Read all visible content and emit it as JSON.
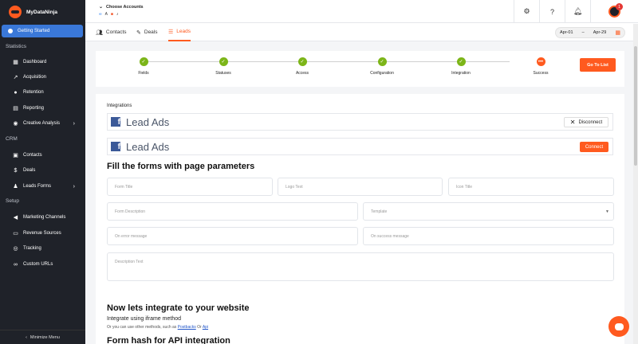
{
  "brand": {
    "name": "MyDataNinja"
  },
  "sidebar": {
    "getting_started": "Getting Started",
    "sections": {
      "statistics": "Statistics",
      "crm": "CRM",
      "setup": "Setup"
    },
    "statistics_items": [
      {
        "label": "Dashboard",
        "icon": "dashboard-icon"
      },
      {
        "label": "Acquisition",
        "icon": "trend-icon"
      },
      {
        "label": "Retention",
        "icon": "users-icon"
      },
      {
        "label": "Reporting",
        "icon": "report-icon"
      },
      {
        "label": "Creative Analysis",
        "icon": "palette-icon"
      }
    ],
    "crm_items": [
      {
        "label": "Contacts",
        "icon": "contacts-icon"
      },
      {
        "label": "Deals",
        "icon": "dollar-icon"
      },
      {
        "label": "Leads Forms",
        "icon": "leads-icon"
      }
    ],
    "setup_items": [
      {
        "label": "Marketing Channels",
        "icon": "megaphone-icon"
      },
      {
        "label": "Revenue Sources",
        "icon": "money-icon"
      },
      {
        "label": "Tracking",
        "icon": "tracking-icon"
      },
      {
        "label": "Custom URLs",
        "icon": "link-icon"
      }
    ],
    "minimize": "Minimize Menu"
  },
  "topbar": {
    "choose_accounts": "Choose Accounts",
    "notification_count": "1"
  },
  "tabs": [
    {
      "label": "Contacts",
      "icon": "contacts-icon"
    },
    {
      "label": "Deals",
      "icon": "handshake-icon"
    },
    {
      "label": "Leads",
      "icon": "list-icon",
      "active": true
    }
  ],
  "date_range": {
    "from": "Apr-01",
    "sep": "–",
    "to": "Apr-29"
  },
  "steps": [
    {
      "label": "Fields",
      "status": "done"
    },
    {
      "label": "Statuses",
      "status": "done"
    },
    {
      "label": "Access",
      "status": "done"
    },
    {
      "label": "Configuration",
      "status": "done"
    },
    {
      "label": "Integration",
      "status": "done"
    },
    {
      "label": "Success",
      "status": "current"
    }
  ],
  "go_to_list": "Go To List",
  "integrations": {
    "label": "Integrations",
    "rows": [
      {
        "name": "Lead Ads",
        "action": "Disconnect"
      },
      {
        "name": "Lead Ads",
        "action": "Connect"
      }
    ]
  },
  "form_section": {
    "title": "Fill the forms with page parameters",
    "placeholders": {
      "form_title": "Form Title",
      "logo_text": "Logo Text",
      "icon_title": "Icon Title",
      "form_description": "Form Description",
      "template": "Template",
      "on_error": "On error message",
      "on_success": "On success message",
      "description_text": "Description Text"
    }
  },
  "integrate": {
    "title": "Now lets integrate to your website",
    "subtitle": "Integrate using iframe method",
    "note_prefix": "Or you can use other methods, such as",
    "link1": "Postbacks",
    "or": "Or",
    "link2": "Api",
    "hash_title": "Form hash for API integration"
  },
  "colors": {
    "accent": "#ff5a1f",
    "success": "#7cb518",
    "sidebar": "#1f2229",
    "active_nav": "#3a78d8"
  }
}
